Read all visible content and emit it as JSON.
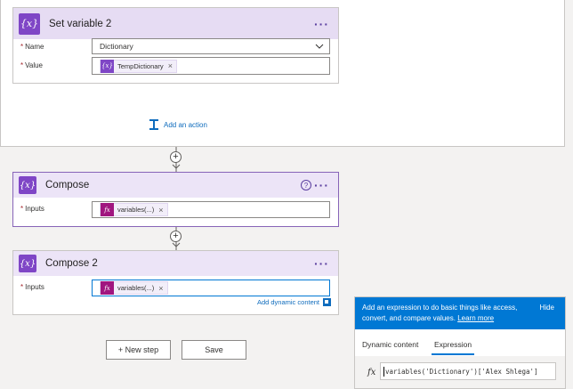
{
  "set_variable": {
    "title": "Set variable 2",
    "icon": "variable-icon",
    "name_label": "Name",
    "name_value": "Dictionary",
    "value_label": "Value",
    "value_token": "TempDictionary"
  },
  "add_action": {
    "label": "Add an action"
  },
  "compose": {
    "title": "Compose",
    "inputs_label": "Inputs",
    "token": "variables(...)"
  },
  "compose2": {
    "title": "Compose 2",
    "inputs_label": "Inputs",
    "token": "variables(...)",
    "dynamic_link": "Add dynamic content"
  },
  "buttons": {
    "new_step": "+ New step",
    "save": "Save"
  },
  "expression_panel": {
    "banner_text": "Add an expression to do basic things like access, convert, and compare values.",
    "learn_more": "Learn more",
    "hide": "Hide",
    "tabs": [
      "Dynamic content",
      "Expression"
    ],
    "active_tab": "Expression",
    "fx_symbol": "fx",
    "input_value": "variables('Dictionary')['Alex Shlega']"
  },
  "symbols": {
    "var_icon_text": "{x}",
    "fx_icon_text": "fx",
    "remove": "×",
    "menu": "···",
    "help": "?",
    "plus": "+",
    "required": "*"
  },
  "colors": {
    "accent": "#0078d4",
    "variable_purple": "#7f46c6",
    "expression_magenta": "#a0167f"
  }
}
